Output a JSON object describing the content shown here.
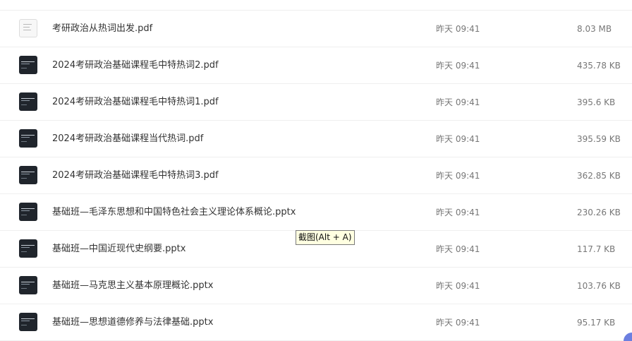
{
  "files": [
    {
      "name": "考研政治从热词出发.pdf",
      "time": "昨天 09:41",
      "size": "8.03 MB",
      "icon": "pdf-thumbnail-icon",
      "theme": "light"
    },
    {
      "name": "2024考研政治基础课程毛中特热词2.pdf",
      "time": "昨天 09:41",
      "size": "435.78 KB",
      "icon": "pdf-thumbnail-icon",
      "theme": "dark"
    },
    {
      "name": "2024考研政治基础课程毛中特热词1.pdf",
      "time": "昨天 09:41",
      "size": "395.6 KB",
      "icon": "pdf-thumbnail-icon",
      "theme": "dark"
    },
    {
      "name": "2024考研政治基础课程当代热词.pdf",
      "time": "昨天 09:41",
      "size": "395.59 KB",
      "icon": "pdf-thumbnail-icon",
      "theme": "dark"
    },
    {
      "name": "2024考研政治基础课程毛中特热词3.pdf",
      "time": "昨天 09:41",
      "size": "362.85 KB",
      "icon": "pdf-thumbnail-icon",
      "theme": "dark"
    },
    {
      "name": "基础班—毛泽东思想和中国特色社会主义理论体系概论.pptx",
      "time": "昨天 09:41",
      "size": "230.26 KB",
      "icon": "pptx-thumbnail-icon",
      "theme": "dark"
    },
    {
      "name": "基础班—中国近现代史纲要.pptx",
      "time": "昨天 09:41",
      "size": "117.7 KB",
      "icon": "pptx-thumbnail-icon",
      "theme": "dark"
    },
    {
      "name": "基础班—马克思主义基本原理概论.pptx",
      "time": "昨天 09:41",
      "size": "103.76 KB",
      "icon": "pptx-thumbnail-icon",
      "theme": "dark"
    },
    {
      "name": "基础班—思想道德修养与法律基础.pptx",
      "time": "昨天 09:41",
      "size": "95.17 KB",
      "icon": "pptx-thumbnail-icon",
      "theme": "dark"
    }
  ],
  "tooltip": {
    "text": "截图(Alt + A)"
  },
  "colors": {
    "thumb_dark": "#20252c",
    "tooltip_bg": "#ffffe1",
    "badge": "#6c7fe0"
  }
}
